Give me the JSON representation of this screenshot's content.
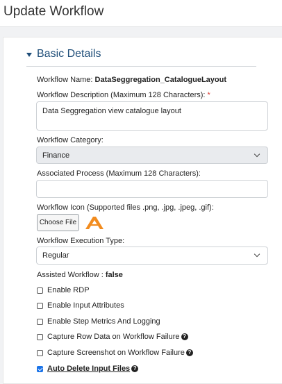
{
  "header": {
    "title": "Update Workflow"
  },
  "section": {
    "title": "Basic Details"
  },
  "form": {
    "name_label": "Workflow Name:",
    "name_value": "DataSeggregation_CatalogueLayout",
    "description_label": "Workflow Description (Maximum 128 Characters):",
    "description_required": "*",
    "description_value": "Data Seggregation view catalogue layout",
    "category_label": "Workflow Category:",
    "category_value": "Finance",
    "process_label": "Associated Process (Maximum 128 Characters):",
    "process_value": "",
    "icon_label": "Workflow Icon (Supported files .png, .jpg, .jpeg, .gif):",
    "choose_file_label": "Choose File",
    "exec_type_label": "Workflow Execution Type:",
    "exec_type_value": "Regular",
    "assisted_label": "Assisted Workflow :",
    "assisted_value": "false"
  },
  "options": [
    {
      "label": "Enable RDP",
      "checked": false,
      "help": false
    },
    {
      "label": "Enable Input Attributes",
      "checked": false,
      "help": false
    },
    {
      "label": "Enable Step Metrics And Logging",
      "checked": false,
      "help": false
    },
    {
      "label": "Capture Row Data on Workflow Failure",
      "checked": false,
      "help": true
    },
    {
      "label": "Capture Screenshot on Workflow Failure",
      "checked": false,
      "help": true
    },
    {
      "label": "Auto Delete Input Files",
      "checked": true,
      "help": true
    }
  ],
  "help_glyph": "?",
  "icons": {
    "section_toggle": "caret-down-icon",
    "workflow_icon": "orange-chevron-logo",
    "help": "question-circle-icon",
    "dropdown": "chevron-down-icon"
  },
  "colors": {
    "section_title": "#1f4e79",
    "checkbox_checked": "#1a73e8",
    "required": "#d9342b",
    "workflow_icon": "#f28c1f"
  }
}
